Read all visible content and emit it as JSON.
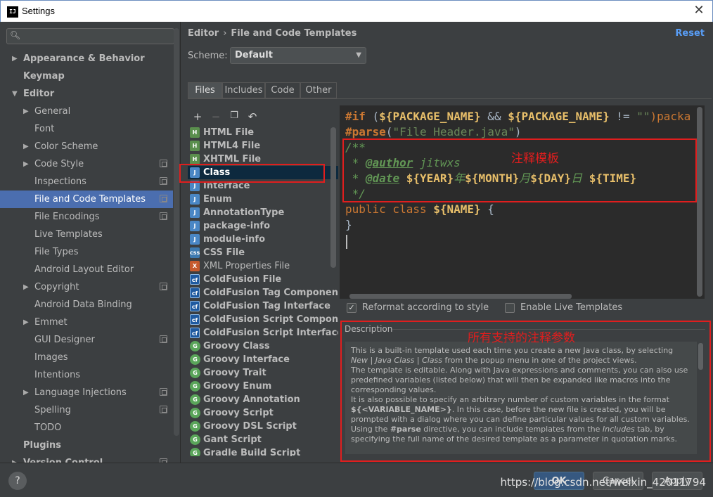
{
  "window": {
    "title": "Settings",
    "app_icon_text": "IJ",
    "close_glyph": "✕"
  },
  "search": {
    "placeholder": "",
    "icon": "search-icon"
  },
  "sidebar": {
    "items": [
      {
        "label": "Appearance & Behavior",
        "bold": true,
        "arrow": "▶"
      },
      {
        "label": "Keymap",
        "bold": true
      },
      {
        "label": "Editor",
        "bold": true,
        "arrow": "▼"
      },
      {
        "label": "General",
        "arrow": "▶"
      },
      {
        "label": "Font"
      },
      {
        "label": "Color Scheme",
        "arrow": "▶"
      },
      {
        "label": "Code Style",
        "arrow": "▶",
        "cfg": true
      },
      {
        "label": "Inspections",
        "cfg": true
      },
      {
        "label": "File and Code Templates",
        "cfg": true,
        "selected": true
      },
      {
        "label": "File Encodings",
        "cfg": true
      },
      {
        "label": "Live Templates"
      },
      {
        "label": "File Types"
      },
      {
        "label": "Android Layout Editor"
      },
      {
        "label": "Copyright",
        "arrow": "▶",
        "cfg": true
      },
      {
        "label": "Android Data Binding"
      },
      {
        "label": "Emmet",
        "arrow": "▶"
      },
      {
        "label": "GUI Designer",
        "cfg": true
      },
      {
        "label": "Images"
      },
      {
        "label": "Intentions"
      },
      {
        "label": "Language Injections",
        "arrow": "▶",
        "cfg": true
      },
      {
        "label": "Spelling",
        "cfg": true
      },
      {
        "label": "TODO"
      },
      {
        "label": "Plugins",
        "bold": true
      },
      {
        "label": "Version Control",
        "bold": true,
        "arrow": "▶",
        "cfg": true
      }
    ]
  },
  "header": {
    "crumb_parent": "Editor",
    "crumb_sep": "›",
    "crumb_current": "File and Code Templates",
    "reset": "Reset",
    "scheme_label": "Scheme:",
    "scheme_value": "Default",
    "scheme_caret": "▼"
  },
  "tabs": [
    "Files",
    "Includes",
    "Code",
    "Other"
  ],
  "list_toolbar": {
    "add": "+",
    "remove": "−",
    "copy": "❐",
    "undo": "↶"
  },
  "templates": [
    {
      "label": "HTML File",
      "icon": "html"
    },
    {
      "label": "HTML4 File",
      "icon": "html"
    },
    {
      "label": "XHTML File",
      "icon": "html"
    },
    {
      "label": "Class",
      "icon": "java",
      "selected": true
    },
    {
      "label": "Interface",
      "icon": "java"
    },
    {
      "label": "Enum",
      "icon": "java"
    },
    {
      "label": "AnnotationType",
      "icon": "java"
    },
    {
      "label": "package-info",
      "icon": "java"
    },
    {
      "label": "module-info",
      "icon": "java"
    },
    {
      "label": "CSS File",
      "icon": "css"
    },
    {
      "label": "XML Properties File",
      "icon": "xml",
      "normal": true
    },
    {
      "label": "ColdFusion File",
      "icon": "cf"
    },
    {
      "label": "ColdFusion Tag Component",
      "icon": "cf"
    },
    {
      "label": "ColdFusion Tag Interface",
      "icon": "cf"
    },
    {
      "label": "ColdFusion Script Component",
      "icon": "cf"
    },
    {
      "label": "ColdFusion Script Interface",
      "icon": "cf"
    },
    {
      "label": "Groovy Class",
      "icon": "groovy"
    },
    {
      "label": "Groovy Interface",
      "icon": "groovy"
    },
    {
      "label": "Groovy Trait",
      "icon": "groovy"
    },
    {
      "label": "Groovy Enum",
      "icon": "groovy"
    },
    {
      "label": "Groovy Annotation",
      "icon": "groovy"
    },
    {
      "label": "Groovy Script",
      "icon": "groovy"
    },
    {
      "label": "Groovy DSL Script",
      "icon": "groovy"
    },
    {
      "label": "Gant Script",
      "icon": "groovy"
    },
    {
      "label": "Gradle Build Script",
      "icon": "groovy"
    }
  ],
  "code": {
    "line1": {
      "a": "#if",
      "b": " (",
      "c": "${PACKAGE_NAME}",
      "d": " && ",
      "e": "${PACKAGE_NAME}",
      "f": " != ",
      "g": "\"\"",
      "h": ")packa"
    },
    "line2": {
      "a": "#parse",
      "b": "(",
      "c": "\"File Header.java\"",
      "d": ")"
    },
    "line3": "/**",
    "line4": {
      "a": " * ",
      "b": "@author",
      "c": " jitwxs"
    },
    "line5": {
      "a": " * ",
      "b": "@date",
      "c": " ",
      "d": "${YEAR}",
      "e": "年",
      "f": "${MONTH}",
      "g": "月",
      "h": "${DAY}",
      "i": "日",
      "j": " ",
      "k": "${TIME}"
    },
    "line6": " */",
    "line7": {
      "a": "public class ",
      "b": "${NAME}",
      "c": " {"
    },
    "line8": "}"
  },
  "options": {
    "reformat": "Reformat according to style",
    "reformat_checked": "✓",
    "live_templates": "Enable Live Templates"
  },
  "description": {
    "title": "Description",
    "p1a": "This is a built-in template used each time you create a new Java class, by selecting ",
    "p1b": "New | Java Class | Class",
    "p1c": " from the popup menu in one of the project views.",
    "p2": "The template is editable. Along with Java expressions and comments, you can also use predefined variables (listed below) that will then be expanded like macros into the corresponding values.",
    "p3a": "It is also possible to specify an arbitrary number of custom variables in the format ",
    "p3b": "${<VARIABLE_NAME>}",
    "p3c": ". In this case, before the new file is created, you will be prompted with a dialog where you can define particular values for all custom variables.",
    "p4a": "Using the ",
    "p4b": "#parse",
    "p4c": " directive, you can include templates from the ",
    "p4d": "Includes",
    "p4e": " tab, by specifying the full name of the desired template as a parameter in quotation marks."
  },
  "annotations": {
    "template_note": "注释模板",
    "params_note": "所有支持的注释参数"
  },
  "footer": {
    "help": "?",
    "ok": "OK",
    "cancel": "Cancel",
    "apply": "Apply",
    "watermark": "https://blog.csdn.net/weixin_42011794"
  },
  "colors": {
    "accent": "#4b6eaf",
    "link": "#589df6",
    "annotation": "#e01e1e",
    "editor_bg": "#2b2b2b"
  }
}
